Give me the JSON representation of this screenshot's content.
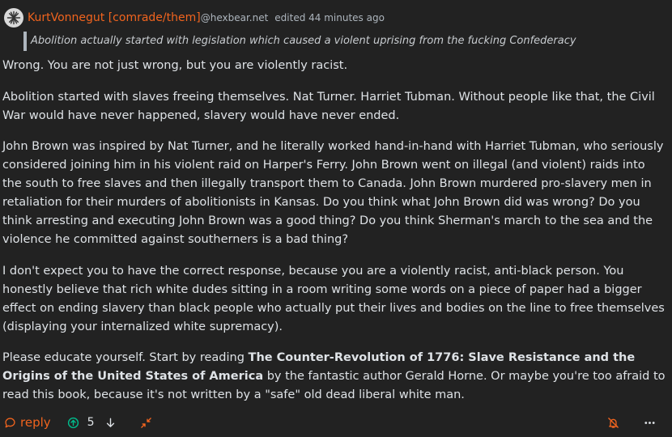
{
  "comment": {
    "author": "KurtVonnegut [comrade/them]",
    "instance": "@hexbear.net",
    "edited": "edited 44 minutes ago",
    "quote": "Abolition actually started with legislation which caused a violent uprising from the fucking Confederacy",
    "paragraphs": [
      "Wrong. You are not just wrong, but you are violently racist.",
      "Abolition started with slaves freeing themselves. Nat Turner. Harriet Tubman. Without people like that, the Civil War would have never happened, slavery would have never ended.",
      "John Brown was inspired by Nat Turner, and he literally worked hand-in-hand with Harriet Tubman, who seriously considered joining him in his violent raid on Harper's Ferry. John Brown went on illegal (and violent) raids into the south to free slaves and then illegally transport them to Canada. John Brown murdered pro-slavery men in retaliation for their murders of abolitionists in Kansas. Do you think what John Brown did was wrong? Do you think arresting and executing John Brown was a good thing? Do you think Sherman's march to the sea and the violence he committed against southerners is a bad thing?",
      "I don't expect you to have the correct response, because you are a violently racist, anti-black person. You honestly believe that rich white dudes sitting in a room writing some words on a piece of paper had a bigger effect on ending slavery than black people who actually put their lives and bodies on the line to free themselves (displaying your internalized white supremacy)."
    ],
    "last_paragraph": {
      "before": "Please educate yourself. Start by reading ",
      "book_title": "The Counter-Revolution of 1776: Slave Resistance and the Origins of the United States of America",
      "after": " by the fantastic author Gerald Horne. Or maybe you're too afraid to read this book, because it's not written by a \"safe\" old dead liberal white man."
    }
  },
  "actions": {
    "reply_label": "reply",
    "score": "5",
    "icons": [
      "reply-icon",
      "upvote-icon",
      "downvote-icon",
      "collapse-icon",
      "mute-notifications-icon",
      "more-options-icon"
    ]
  },
  "colors": {
    "background": "#222222",
    "text": "#dee2e6",
    "accent": "#f1641e",
    "upvote": "#00bc8c",
    "muted": "#adb5bd"
  }
}
